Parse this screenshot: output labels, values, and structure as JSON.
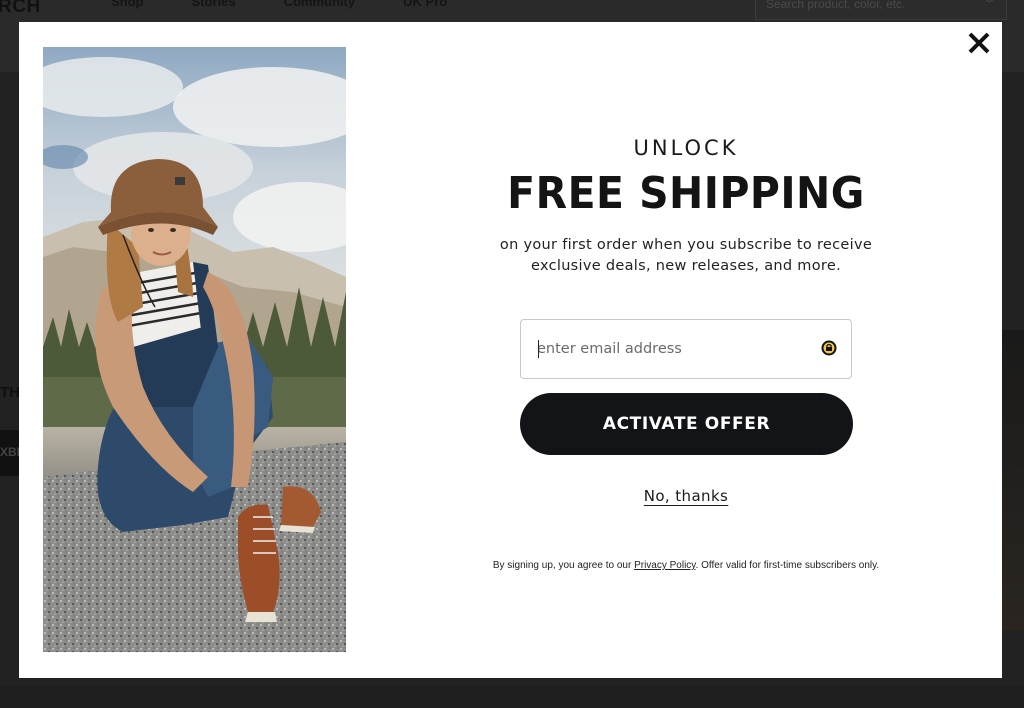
{
  "background": {
    "logo_text": "RCH",
    "nav": [
      "Shop",
      "Stories",
      "Community",
      "UK Pro"
    ],
    "search_placeholder": "Search product, color, etc.",
    "left_text": "THE",
    "left_button": "XBE"
  },
  "modal": {
    "eyebrow": "UNLOCK",
    "headline": "FREE SHIPPING",
    "subtext": "on your first order when you subscribe to receive exclusive deals, new releases, and more.",
    "email_placeholder": "enter email address",
    "cta_label": "ACTIVATE OFFER",
    "decline_label": "No, thanks",
    "legal_prefix": "By signing up, you agree to our ",
    "legal_link": "Privacy Policy",
    "legal_suffix": ". Offer valid for first-time subscribers only."
  },
  "colors": {
    "cta_bg": "#131417",
    "overlay": "#2b2b2b",
    "modal_bg": "#ffffff"
  },
  "icons": {
    "close": "close-icon",
    "password_manager": "password-manager-icon",
    "search": "search-icon"
  }
}
